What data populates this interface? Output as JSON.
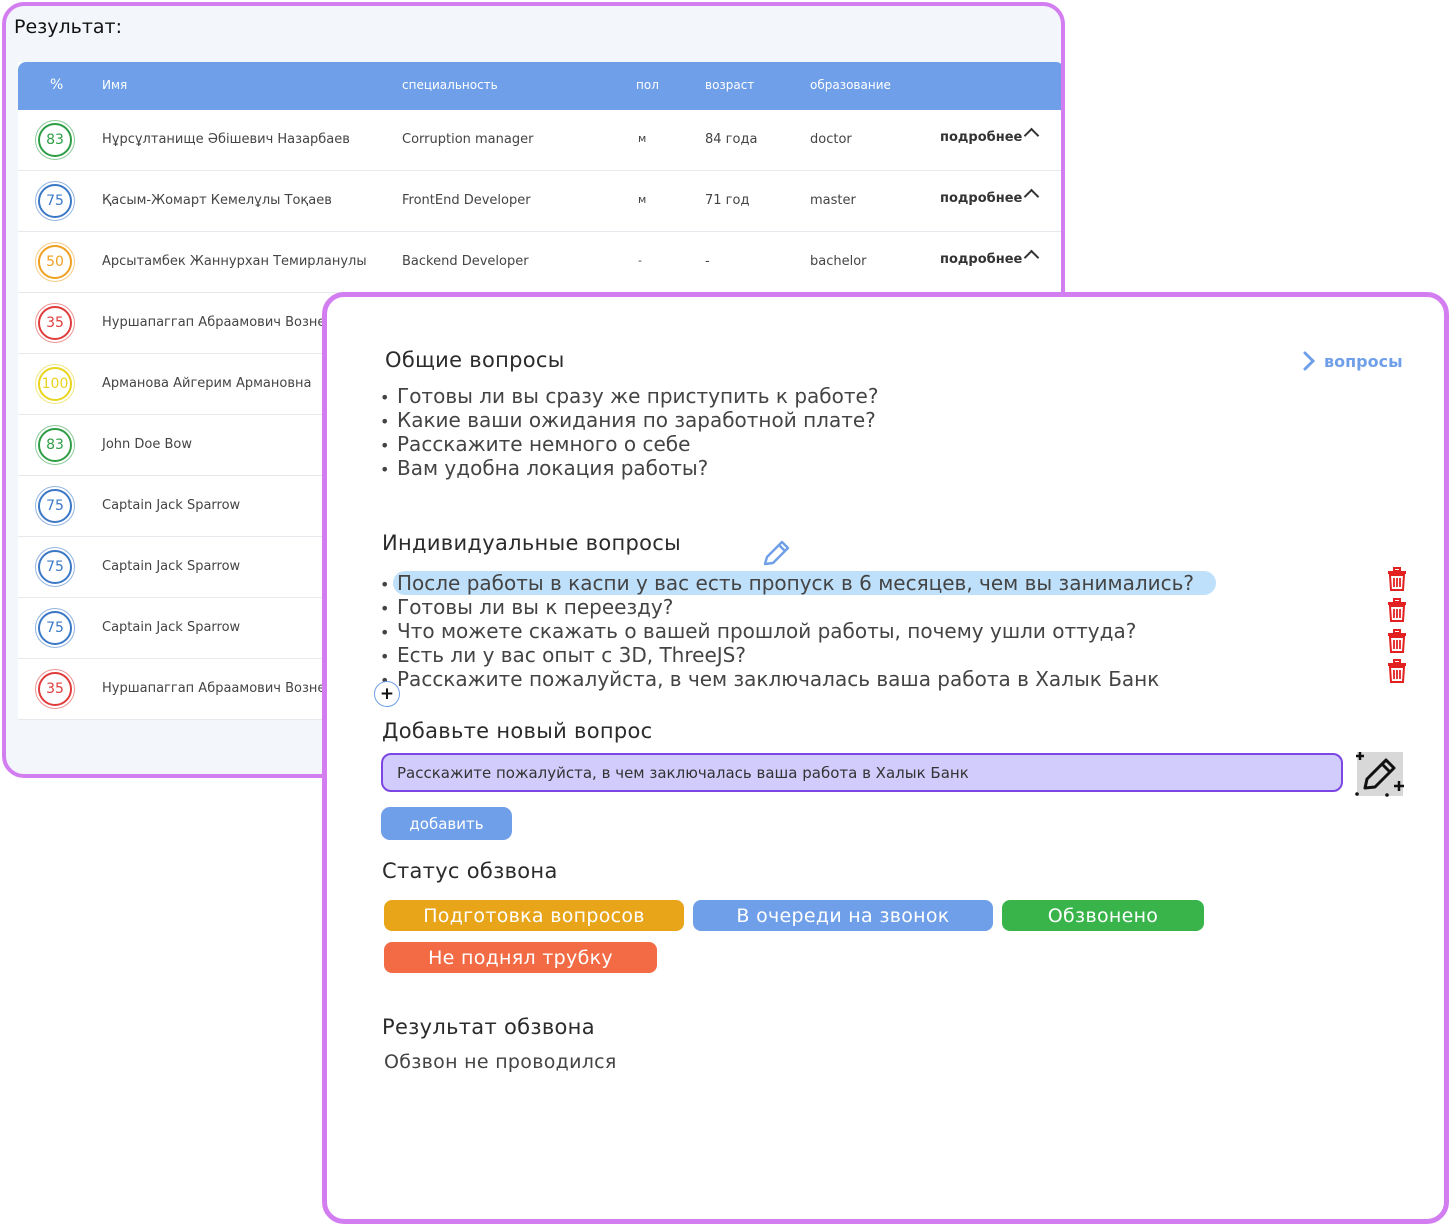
{
  "back": {
    "title": "Результат:",
    "headers": {
      "score": "%",
      "name": "Имя",
      "spec": "специальность",
      "sex": "пол",
      "age": "возраст",
      "edu": "образование"
    },
    "rows": [
      {
        "score": "83",
        "color": "#2e9e46",
        "name": "Нұрсұлтанище Әбішевич Назарбаев",
        "spec": "Corruption manager",
        "sex": "м",
        "age": "84 года",
        "edu": "doctor",
        "more": "подробнее"
      },
      {
        "score": "75",
        "color": "#3b78c6",
        "name": "Қасым-Жомарт Кемелұлы Тоқаев",
        "spec": "FrontEnd Developer",
        "sex": "м",
        "age": "71 год",
        "edu": "master",
        "more": "подробнее"
      },
      {
        "score": "50",
        "color": "#f0a020",
        "name": "Арсытамбек Жаннурхан Темирланулы",
        "spec": "Backend Developer",
        "sex": "-",
        "age": "-",
        "edu": "bachelor",
        "more": "подробнее"
      },
      {
        "score": "35",
        "color": "#e03c3c",
        "name": "Нуршапаггап Абраамович Вознесенский"
      },
      {
        "score": "100",
        "color": "#e8d41c",
        "name": "Арманова Айгерим Армановна"
      },
      {
        "score": "83",
        "color": "#2e9e46",
        "name": "John Doe Bow"
      },
      {
        "score": "75",
        "color": "#3b78c6",
        "name": "Captain Jack Sparrow"
      },
      {
        "score": "75",
        "color": "#3b78c6",
        "name": "Captain Jack Sparrow"
      },
      {
        "score": "75",
        "color": "#3b78c6",
        "name": "Captain Jack Sparrow"
      },
      {
        "score": "35",
        "color": "#e03c3c",
        "name": "Нуршапаггап Абраамович Вознесенский"
      }
    ]
  },
  "front": {
    "general_title": "Общие вопросы",
    "questions_link": "вопросы",
    "general_questions": [
      "Готовы ли вы сразу же приступить к работе?",
      "Какие ваши ожидания по заработной плате?",
      "Расскажите немного о себе",
      "Вам удобна локация работы?"
    ],
    "individual_title": "Индивидуальные вопросы",
    "individual_questions": [
      "После работы в каспи у вас есть пропуск в 6 месяцев, чем вы занимались?",
      "Готовы ли вы к переезду?",
      "Что можете скажать о вашей прошлой работы, почему ушли оттуда?",
      "Есть ли у вас опыт с 3D, ThreeJS?",
      "Расскажите пожалуйста, в чем заключалась ваша работа в Халык Банк"
    ],
    "add_title": "Добавьте новый вопрос",
    "new_question_value": "Расскажите пожалуйста, в чем заключалась ваша работа в Халык Банк",
    "add_button": "добавить",
    "status_title": "Статус обзвона",
    "statuses": [
      {
        "label": "Подготовка вопросов",
        "color": "#e9a519"
      },
      {
        "label": "В очереди на звонок",
        "color": "#6f9fe8"
      },
      {
        "label": "Обзвонено",
        "color": "#38b44a"
      },
      {
        "label": "Не поднял трубку",
        "color": "#f26b44"
      }
    ],
    "result_title": "Результат обзвона",
    "result_text": "Обзвон не проводился",
    "icons": {
      "questions_link": "chevron-right-icon",
      "edit": "pencil-icon",
      "add": "plus-icon",
      "delete": "trash-icon",
      "ai_edit": "magic-pencil-icon"
    }
  }
}
